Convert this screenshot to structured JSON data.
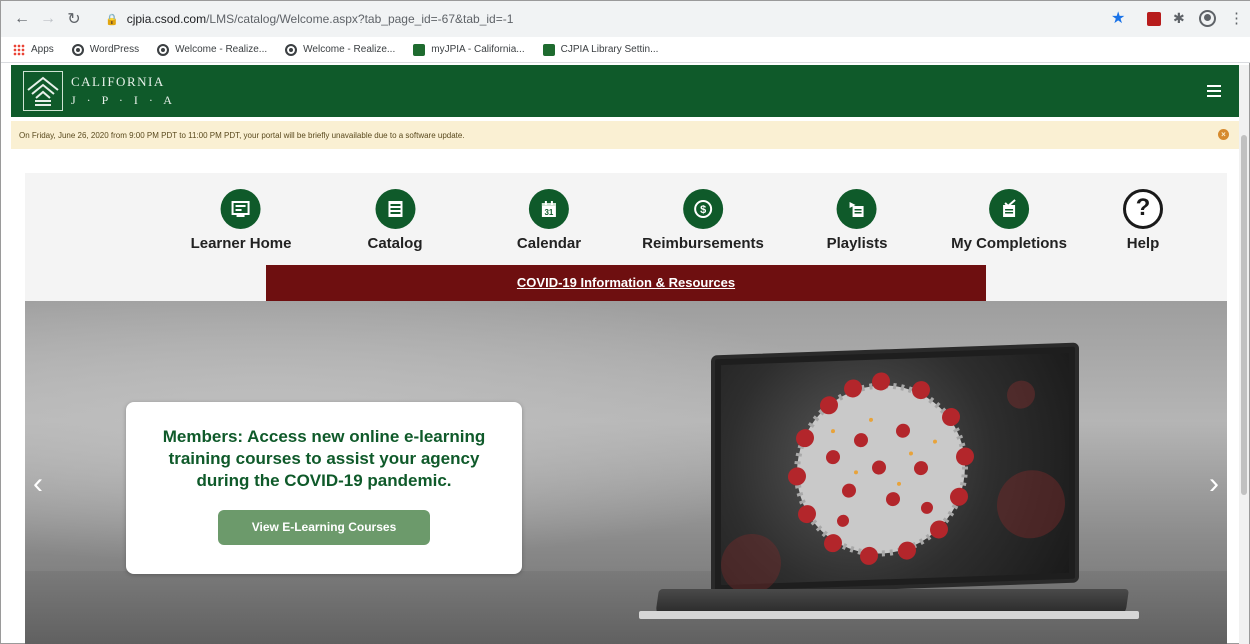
{
  "browser": {
    "url_host": "cjpia.csod.com",
    "url_path": "/LMS/catalog/Welcome.aspx?tab_page_id=-67&tab_id=-1",
    "bookmarks": [
      {
        "label": "Apps",
        "icon": "apps-grid-icon"
      },
      {
        "label": "WordPress",
        "icon": "wordpress-icon"
      },
      {
        "label": "Welcome - Realize...",
        "icon": "wordpress-icon"
      },
      {
        "label": "Welcome - Realize...",
        "icon": "wordpress-icon"
      },
      {
        "label": "myJPIA - California...",
        "icon": "jpia-icon"
      },
      {
        "label": "CJPIA Library Settin...",
        "icon": "jpia-icon"
      }
    ]
  },
  "header": {
    "logo_line1": "CALIFORNIA",
    "logo_line2": "J · P · I · A",
    "brand_color": "#0f5a2a"
  },
  "notice": {
    "text": "On Friday, June 26, 2020 from 9:00 PM PDT to 11:00 PM PDT, your portal will be briefly unavailable due to a software update."
  },
  "nav": [
    {
      "label": "Learner Home",
      "icon": "learner-home-icon"
    },
    {
      "label": "Catalog",
      "icon": "catalog-icon"
    },
    {
      "label": "Calendar",
      "icon": "calendar-icon"
    },
    {
      "label": "Reimbursements",
      "icon": "reimbursements-icon"
    },
    {
      "label": "Playlists",
      "icon": "playlists-icon"
    },
    {
      "label": "My Completions",
      "icon": "completions-icon"
    },
    {
      "label": "Help",
      "icon": "help-icon"
    }
  ],
  "covid": {
    "link_text": "COVID-19 Information & Resources",
    "bar_color": "#6e0f10"
  },
  "hero": {
    "promo_text": "Members: Access new online e-learning training courses to assist your agency during the COVID-19 pandemic.",
    "button_label": "View E-Learning Courses"
  }
}
